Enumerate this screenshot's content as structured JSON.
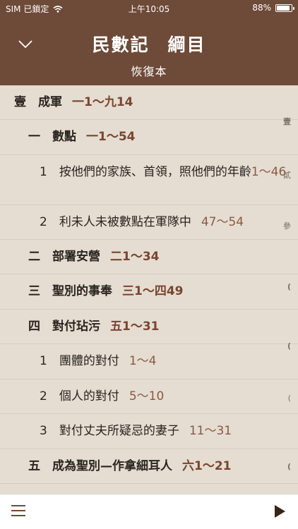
{
  "status_bar": {
    "carrier": "SIM 已鎖定",
    "wifi_icon": "wifi-icon",
    "time": "上午10:05",
    "battery_text": "88%",
    "battery_level": 0.88
  },
  "header": {
    "back_icon": "chevron-down-icon",
    "title_part1": "民數記",
    "title_part2": "綱目",
    "subtitle": "恢復本"
  },
  "outline": [
    {
      "label": "壹　成軍",
      "ref": "一1～九14",
      "side": "壹"
    },
    {
      "label": "一　數點",
      "ref": "一1～54",
      "side": ""
    },
    {
      "label": "1　按他們的家族、首領，照他們的年齡",
      "ref": "1～46",
      "side": "貳"
    },
    {
      "label": "2　利未人未被數點在軍隊中",
      "ref": "47～54",
      "side": "參"
    },
    {
      "label": "二　部署安營",
      "ref": "二1～34",
      "side": ""
    },
    {
      "label": "三　聖別的事奉",
      "ref": "三1～四49",
      "side": "("
    },
    {
      "label": "四　對付玷污",
      "ref": "五1～31",
      "side": "("
    },
    {
      "label": "1　團體的對付",
      "ref": "1～4",
      "side": ""
    },
    {
      "label": "2　個人的對付",
      "ref": "5～10",
      "side": "("
    },
    {
      "label": "3　對付丈夫所疑忌的妻子",
      "ref": "11～31",
      "side": ""
    },
    {
      "label": "五　成為聖別—作拿細耳人",
      "ref": "六1～21",
      "side": "("
    }
  ],
  "bottom_bar": {
    "menu_icon": "menu-icon",
    "play_icon": "play-icon"
  },
  "colors": {
    "header_bg": "#6e4a38",
    "content_bg": "#e5ddd1",
    "ref_text": "#7a4530"
  }
}
